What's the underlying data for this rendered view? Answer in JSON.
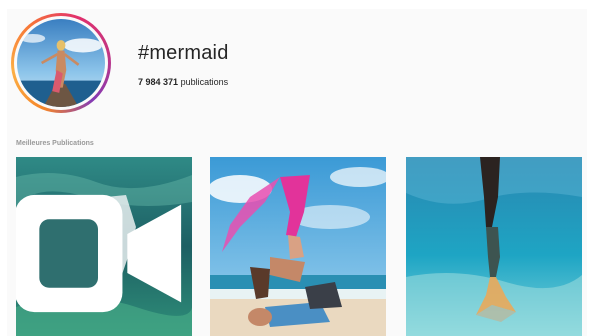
{
  "header": {
    "hashtag": "#mermaid",
    "post_count": "7 984 371",
    "post_count_label": "publications"
  },
  "top_posts": {
    "title": "Meilleures Publications",
    "items": [
      {
        "kind": "video",
        "icon": "video-camera-icon",
        "subject": "underwater mermaid photo"
      },
      {
        "kind": "photo",
        "subject": "acrobatic mermaid tail on beach"
      },
      {
        "kind": "photo",
        "subject": "mermaid tail underwater shallow"
      }
    ]
  },
  "colors": {
    "ring_gradient": [
      "#f58529",
      "#fcaf45",
      "#e1306c",
      "#c13584",
      "#833ab4"
    ],
    "text_primary": "#262626",
    "text_muted": "#999999"
  }
}
